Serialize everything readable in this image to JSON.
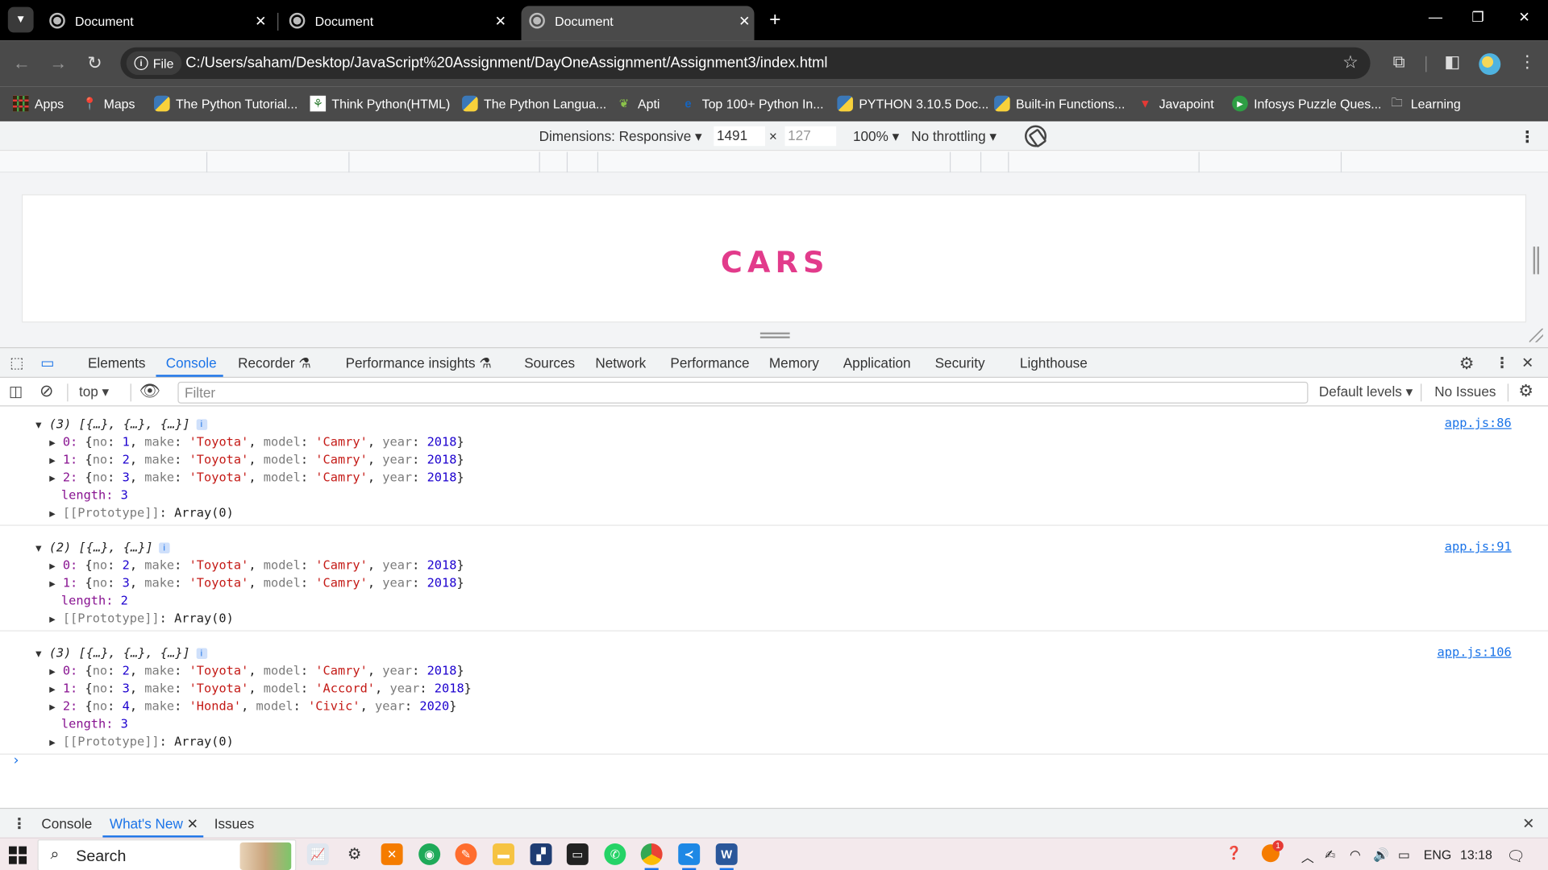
{
  "browser": {
    "tabs": [
      {
        "title": "Document",
        "active": false
      },
      {
        "title": "Document",
        "active": false
      },
      {
        "title": "Document",
        "active": true
      }
    ],
    "address": {
      "scheme_chip": "File",
      "url": "C:/Users/saham/Desktop/JavaScript%20Assignment/DayOneAssignment/Assignment3/index.html"
    },
    "bookmarks": [
      {
        "label": "Apps",
        "icon": "apps-grid-icon"
      },
      {
        "label": "Maps",
        "icon": "maps-pin-icon"
      },
      {
        "label": "The Python Tutorial...",
        "icon": "python-icon"
      },
      {
        "label": "Think Python(HTML)",
        "icon": "green-bookmark-icon"
      },
      {
        "label": "The Python Langua...",
        "icon": "python-icon"
      },
      {
        "label": "Apti",
        "icon": "leaf-icon"
      },
      {
        "label": "Top 100+ Python In...",
        "icon": "edureka-icon"
      },
      {
        "label": "PYTHON 3.10.5 Doc...",
        "icon": "python-icon"
      },
      {
        "label": "Built-in Functions...",
        "icon": "python-icon"
      },
      {
        "label": "Javapoint",
        "icon": "javapoint-icon"
      },
      {
        "label": "Infosys Puzzle Ques...",
        "icon": "green-circle-icon"
      },
      {
        "label": "Learning",
        "icon": "folder-icon"
      }
    ]
  },
  "device_toolbar": {
    "dimensions_label": "Dimensions: Responsive",
    "width": "1491",
    "times": "×",
    "height": "127",
    "zoom": "100%",
    "throttling": "No throttling"
  },
  "page": {
    "heading": "CARS"
  },
  "devtools": {
    "tabs": [
      "Elements",
      "Console",
      "Recorder",
      "Performance insights",
      "Sources",
      "Network",
      "Performance",
      "Memory",
      "Application",
      "Security",
      "Lighthouse"
    ],
    "active_tab": "Console",
    "context": "top",
    "filter_placeholder": "Filter",
    "levels": "Default levels",
    "issues": "No Issues",
    "console_groups": [
      {
        "summary": "(3) [{…}, {…}, {…}]",
        "source": "app.js:86",
        "entries": [
          {
            "index": "0",
            "no": "1",
            "make": "'Toyota'",
            "model": "'Camry'",
            "year": "2018"
          },
          {
            "index": "1",
            "no": "2",
            "make": "'Toyota'",
            "model": "'Camry'",
            "year": "2018"
          },
          {
            "index": "2",
            "no": "3",
            "make": "'Toyota'",
            "model": "'Camry'",
            "year": "2018"
          }
        ],
        "length": "3"
      },
      {
        "summary": "(2) [{…}, {…}]",
        "source": "app.js:91",
        "entries": [
          {
            "index": "0",
            "no": "2",
            "make": "'Toyota'",
            "model": "'Camry'",
            "year": "2018"
          },
          {
            "index": "1",
            "no": "3",
            "make": "'Toyota'",
            "model": "'Camry'",
            "year": "2018"
          }
        ],
        "length": "2"
      },
      {
        "summary": "(3) [{…}, {…}, {…}]",
        "source": "app.js:106",
        "entries": [
          {
            "index": "0",
            "no": "2",
            "make": "'Toyota'",
            "model": "'Camry'",
            "year": "2018"
          },
          {
            "index": "1",
            "no": "3",
            "make": "'Toyota'",
            "model": "'Accord'",
            "year": "2018"
          },
          {
            "index": "2",
            "no": "4",
            "make": "'Honda'",
            "model": "'Civic'",
            "year": "2020"
          }
        ],
        "length": "3"
      }
    ],
    "prototype_label": "[[Prototype]]",
    "prototype_value": "Array(0)",
    "length_key": "length",
    "drawer_tabs": [
      "Console",
      "What's New",
      "Issues"
    ],
    "drawer_active": "What's New"
  },
  "taskbar": {
    "search_label": "Search",
    "language": "ENG",
    "time": "13:18",
    "notification_count": "1"
  }
}
